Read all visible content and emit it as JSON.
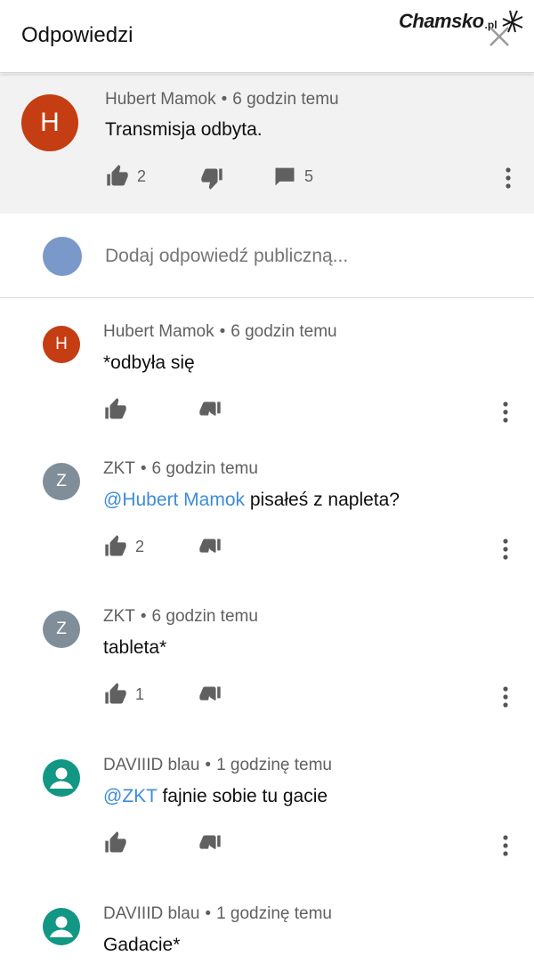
{
  "header": {
    "title": "Odpowiedzi",
    "watermark": {
      "name": "Chamsko",
      "tld": ".pl"
    }
  },
  "top_comment": {
    "author": "Hubert Mamok",
    "time": "6 godzin temu",
    "text": "Transmisja odbyta.",
    "likes": "2",
    "replies": "5",
    "avatar_letter": "H",
    "avatar_color": "#c53d12"
  },
  "reply_box": {
    "placeholder": "Dodaj odpowiedź publiczną...",
    "avatar_color": "#7a98c9"
  },
  "replies": [
    {
      "author": "Hubert Mamok",
      "time": "6 godzin temu",
      "mention": "",
      "text": "*odbyła się",
      "likes": "",
      "avatar_letter": "H",
      "avatar_color": "#c53d12"
    },
    {
      "author": "ZKT",
      "time": "6 godzin temu",
      "mention": "@Hubert Mamok",
      "text": " pisałeś z napleta?",
      "likes": "2",
      "avatar_letter": "Z",
      "avatar_color": "#7f8e98"
    },
    {
      "author": "ZKT",
      "time": "6 godzin temu",
      "mention": "",
      "text": "tableta*",
      "likes": "1",
      "avatar_letter": "Z",
      "avatar_color": "#7f8e98"
    },
    {
      "author": "DAVIIID blau",
      "time": "1 godzinę temu",
      "mention": "@ZKT",
      "text": " fajnie sobie tu gacie",
      "likes": "",
      "avatar_letter": "",
      "avatar_color": "#119784"
    },
    {
      "author": "DAVIIID blau",
      "time": "1 godzinę temu",
      "mention": "",
      "text": "Gadacie*",
      "likes": "",
      "avatar_letter": "",
      "avatar_color": "#119784"
    }
  ],
  "meta_separator": "•"
}
